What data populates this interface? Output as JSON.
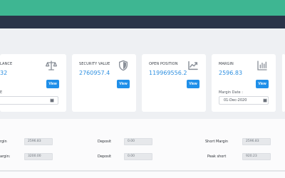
{
  "header": {
    "accent": "#3eb692",
    "nav_bg": "#2a3449"
  },
  "cards": [
    {
      "title": "LANCE",
      "value": "32",
      "button": "View",
      "date_label": "E",
      "icon": "scale-icon"
    },
    {
      "title": "SECURITY VALUE",
      "value": "2760957.4",
      "button": "View",
      "icon": "shield-icon"
    },
    {
      "title": "OPEN POSITION",
      "value": "119969556.2",
      "button": "View",
      "icon": "chart-line-icon"
    },
    {
      "title": "MARGIN",
      "value": "2596.83",
      "button": "View",
      "date_label": "Margin Date :",
      "date_value": "01-Dec-2020",
      "icon": "bar-chart-icon"
    }
  ],
  "rows": [
    {
      "label1": "rgin",
      "value1": "2596.83",
      "label2": "Deposit",
      "value2": "0.00",
      "label3": "Short Margin",
      "value3": "2596.83"
    },
    {
      "label1": "argin:",
      "value1": "3200.00",
      "label2": "Deposit",
      "value2": "0.00",
      "label3": "Peak short",
      "value3": "920.23"
    }
  ],
  "colors": {
    "link_value": "#2d8fe0",
    "button": "#1f8fe9"
  }
}
